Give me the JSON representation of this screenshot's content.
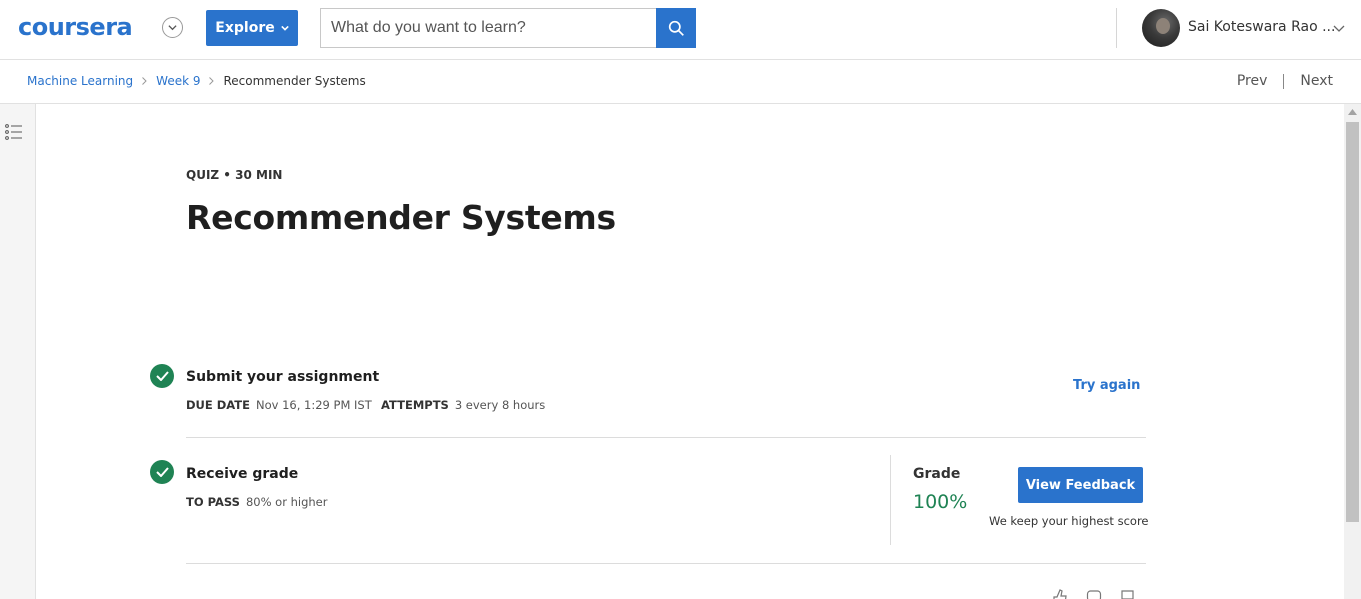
{
  "header": {
    "logo_text": "coursera",
    "explore_label": "Explore",
    "search_placeholder": "What do you want to learn?",
    "username": "Sai Koteswara Rao ...",
    "brand_color": "#2a73cc"
  },
  "breadcrumb": {
    "items": [
      "Machine Learning",
      "Week 9",
      "Recommender Systems"
    ]
  },
  "nav": {
    "prev_label": "Prev",
    "next_label": "Next"
  },
  "quiz": {
    "meta": "QUIZ • 30 MIN",
    "title": "Recommender Systems"
  },
  "submit_step": {
    "title": "Submit your assignment",
    "due_label": "DUE DATE",
    "due_value": "Nov 16, 1:29 PM IST",
    "attempts_label": "ATTEMPTS",
    "attempts_value": "3 every 8 hours",
    "action_label": "Try again",
    "status": "complete"
  },
  "grade_step": {
    "title": "Receive grade",
    "pass_label": "TO PASS",
    "pass_value": "80% or higher",
    "grade_label": "Grade",
    "grade_value": "100%",
    "feedback_button": "View Feedback",
    "note": "We keep your highest score",
    "status": "complete",
    "success_color": "#1f8354"
  },
  "icons": {
    "search": "search-icon",
    "menu": "list-menu-icon",
    "check": "check-circle-icon",
    "chevron": "chevron-down-icon",
    "thumbs_up": "thumbs-up-icon",
    "comment": "comment-icon",
    "flag": "flag-icon"
  }
}
